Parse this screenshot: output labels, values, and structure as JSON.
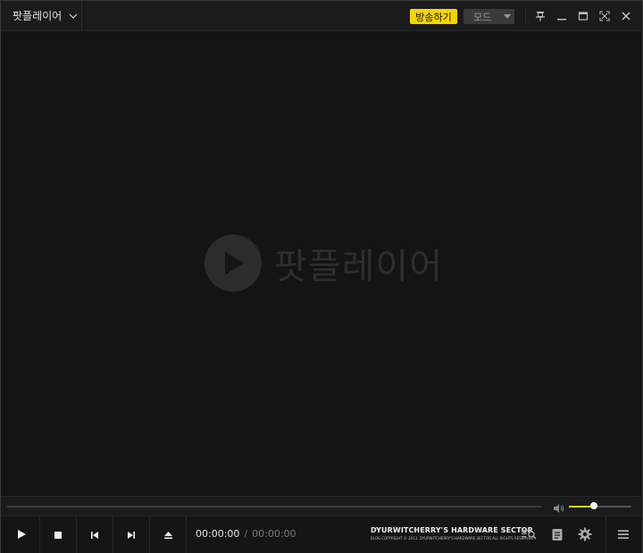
{
  "titlebar": {
    "app_name": "팟플레이어",
    "broadcast_label": "방송하기",
    "mode_label": "모드",
    "icons": [
      "pin-icon",
      "minimize-icon",
      "maximize-icon",
      "fullscreen-icon",
      "close-icon"
    ]
  },
  "video": {
    "logo_text": "팟플레이어"
  },
  "seek": {
    "progress": 0,
    "volume": 0.4
  },
  "controls": {
    "current_time": "00:00:00",
    "separator": "/",
    "total_time": "00:00:00",
    "brand_title": "DYURWITCHERRY'S HARDWARE SECTOR",
    "brand_sub": "BLOG COPYRIGHT © 2013. DYURWITCHERRY'S HARDWARE SECTOR ALL RIGHTS RESERVED.",
    "buttons": [
      "play-icon",
      "stop-icon",
      "previous-icon",
      "next-icon",
      "eject-icon"
    ],
    "right_icons": [
      "playlist-search-icon",
      "notes-icon",
      "settings-icon",
      "menu-icon"
    ]
  },
  "colors": {
    "accent": "#f5d400",
    "background": "#141414",
    "bar": "#1b1b1b"
  }
}
